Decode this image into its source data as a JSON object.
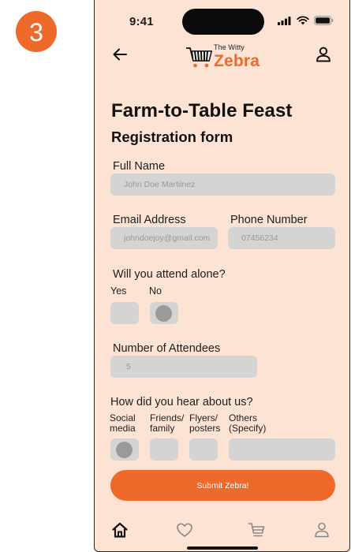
{
  "step": {
    "number": "3"
  },
  "status_bar": {
    "time": "9:41"
  },
  "brand": {
    "tagline": "The Witty",
    "name": "Zebra"
  },
  "header": {
    "title": "Farm-to-Table Feast",
    "subtitle": "Registration form"
  },
  "form": {
    "full_name": {
      "label": "Full Name",
      "value": "John Doe Martiinez"
    },
    "email": {
      "label": "Email Address",
      "value": "johndoejoy@gmail.com"
    },
    "phone": {
      "label": "Phone Number",
      "value": "07456234"
    },
    "attend_alone": {
      "question": "Will you attend alone?",
      "options": [
        {
          "label": "Yes",
          "selected": false
        },
        {
          "label": "No",
          "selected": true
        }
      ]
    },
    "attendees": {
      "label": "Number of Attendees",
      "value": "5"
    },
    "source": {
      "question": "How did you hear about us?",
      "options": [
        {
          "label_line1": "Social",
          "label_line2": "media",
          "selected": true
        },
        {
          "label_line1": "Friends/",
          "label_line2": "family",
          "selected": false
        },
        {
          "label_line1": "Flyers/",
          "label_line2": "posters",
          "selected": false
        },
        {
          "label_line1": "Others",
          "label_line2": "(Specify)",
          "selected": false
        }
      ],
      "others_value": ""
    },
    "submit_label": "Submit Zebra!"
  },
  "tab_bar": {
    "items": [
      "home-icon",
      "heart-icon",
      "cart-icon",
      "user-icon"
    ],
    "active": "home-icon"
  },
  "colors": {
    "accent": "#ef6a2a",
    "background": "#fde3d3",
    "field": "#d6d4d3",
    "selected_dot": "#9b9a99"
  }
}
